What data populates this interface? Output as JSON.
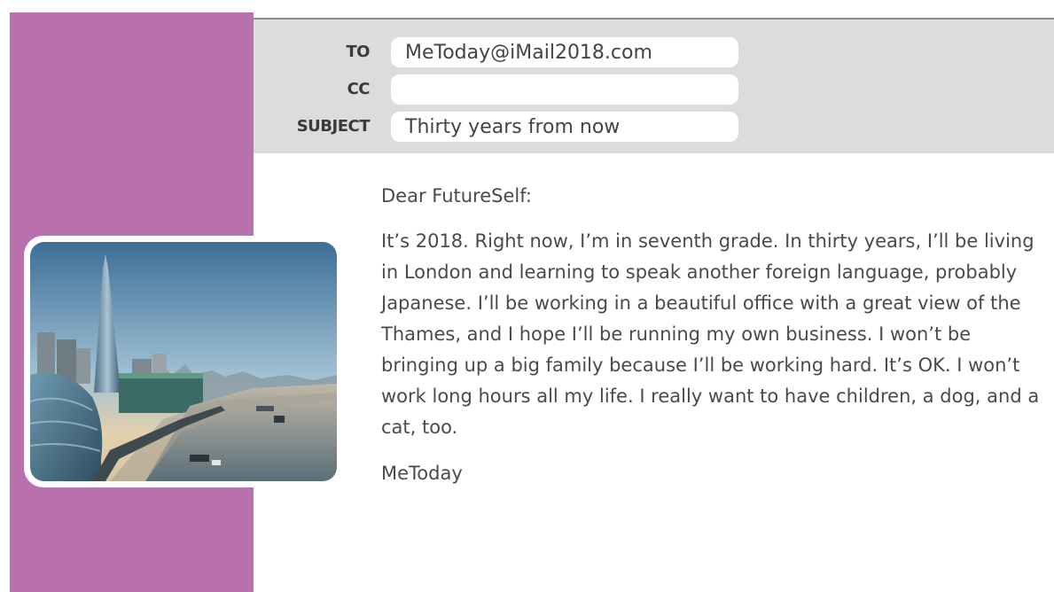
{
  "email": {
    "to_label": "TO",
    "to_value": "MeToday@iMail2018.com",
    "cc_label": "CC",
    "cc_value": "",
    "subject_label": "SUBJECT",
    "subject_value": "Thirty years from now"
  },
  "letter": {
    "greeting": "Dear FutureSelf:",
    "body": "It’s 2018. Right now, I’m in seventh grade. In thirty years, I’ll be living in London and learning to speak another foreign language, probably Japanese. I’ll be working in a beautiful office with a great view of the Thames, and I hope I’ll be running my own business. I won’t be bringing up a big family because I’ll be working hard. It’s OK. I won’t work long hours all my life. I really want to have children, a dog, and a cat, too.",
    "signature": "MeToday"
  },
  "colors": {
    "sidebar": "#b871ac",
    "header": "#dcdcdc"
  },
  "photo": {
    "icon": "london-skyline-photo"
  }
}
